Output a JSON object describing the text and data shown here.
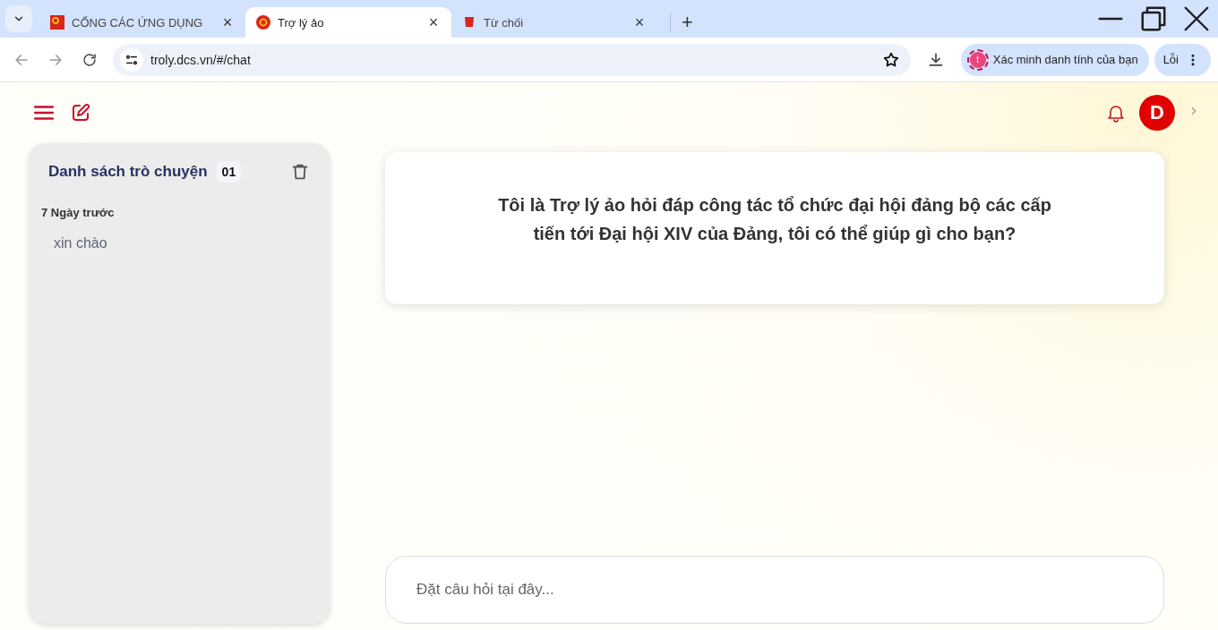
{
  "browser": {
    "tabs": [
      {
        "title": "CỔNG CÁC ỨNG DỤNG",
        "selected": false,
        "close": "×"
      },
      {
        "title": "Trợ lý ảo",
        "selected": true,
        "close": "×"
      },
      {
        "title": "Từ chối",
        "selected": false,
        "close": "×"
      }
    ],
    "new_tab": "+",
    "address": "troly.dcs.vn/#/chat",
    "profile": {
      "avatar_letter": "t",
      "label": "Xác minh danh tính của bạn"
    },
    "error_button": "Lỗi"
  },
  "header": {
    "avatar_letter": "D"
  },
  "sidebar": {
    "title": "Danh sách trò chuyện",
    "count": "01",
    "groups": [
      {
        "label": "7 Ngày trước",
        "items": [
          {
            "title": "xin chào",
            "selected": false
          }
        ]
      }
    ]
  },
  "welcome": {
    "text": "Tôi là Trợ lý ảo hỏi đáp công tác tổ chức đại hội đảng bộ các cấp tiến tới Đại hội XIV của Đảng, tôi có thể giúp gì cho bạn?"
  },
  "composer": {
    "placeholder": "Đặt câu hỏi tại đây..."
  }
}
